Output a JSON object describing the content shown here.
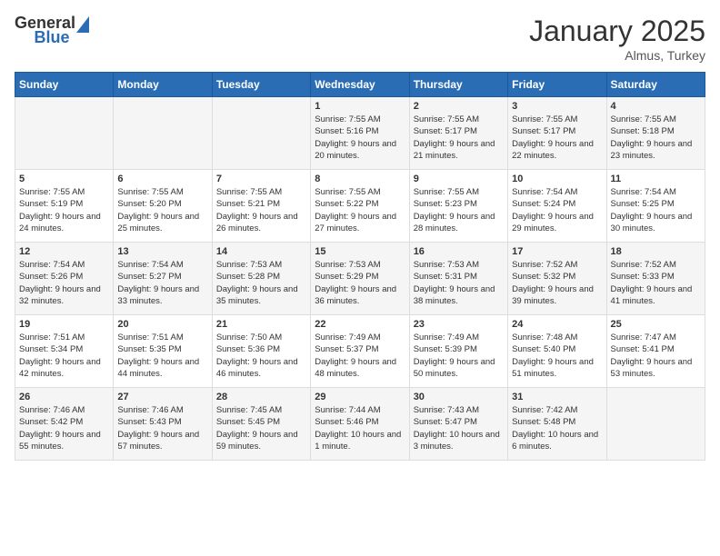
{
  "header": {
    "logo_general": "General",
    "logo_blue": "Blue",
    "month_title": "January 2025",
    "location": "Almus, Turkey"
  },
  "days_of_week": [
    "Sunday",
    "Monday",
    "Tuesday",
    "Wednesday",
    "Thursday",
    "Friday",
    "Saturday"
  ],
  "weeks": [
    {
      "days": [
        {
          "number": "",
          "sunrise": "",
          "sunset": "",
          "daylight": ""
        },
        {
          "number": "",
          "sunrise": "",
          "sunset": "",
          "daylight": ""
        },
        {
          "number": "",
          "sunrise": "",
          "sunset": "",
          "daylight": ""
        },
        {
          "number": "1",
          "sunrise": "Sunrise: 7:55 AM",
          "sunset": "Sunset: 5:16 PM",
          "daylight": "Daylight: 9 hours and 20 minutes."
        },
        {
          "number": "2",
          "sunrise": "Sunrise: 7:55 AM",
          "sunset": "Sunset: 5:17 PM",
          "daylight": "Daylight: 9 hours and 21 minutes."
        },
        {
          "number": "3",
          "sunrise": "Sunrise: 7:55 AM",
          "sunset": "Sunset: 5:17 PM",
          "daylight": "Daylight: 9 hours and 22 minutes."
        },
        {
          "number": "4",
          "sunrise": "Sunrise: 7:55 AM",
          "sunset": "Sunset: 5:18 PM",
          "daylight": "Daylight: 9 hours and 23 minutes."
        }
      ]
    },
    {
      "days": [
        {
          "number": "5",
          "sunrise": "Sunrise: 7:55 AM",
          "sunset": "Sunset: 5:19 PM",
          "daylight": "Daylight: 9 hours and 24 minutes."
        },
        {
          "number": "6",
          "sunrise": "Sunrise: 7:55 AM",
          "sunset": "Sunset: 5:20 PM",
          "daylight": "Daylight: 9 hours and 25 minutes."
        },
        {
          "number": "7",
          "sunrise": "Sunrise: 7:55 AM",
          "sunset": "Sunset: 5:21 PM",
          "daylight": "Daylight: 9 hours and 26 minutes."
        },
        {
          "number": "8",
          "sunrise": "Sunrise: 7:55 AM",
          "sunset": "Sunset: 5:22 PM",
          "daylight": "Daylight: 9 hours and 27 minutes."
        },
        {
          "number": "9",
          "sunrise": "Sunrise: 7:55 AM",
          "sunset": "Sunset: 5:23 PM",
          "daylight": "Daylight: 9 hours and 28 minutes."
        },
        {
          "number": "10",
          "sunrise": "Sunrise: 7:54 AM",
          "sunset": "Sunset: 5:24 PM",
          "daylight": "Daylight: 9 hours and 29 minutes."
        },
        {
          "number": "11",
          "sunrise": "Sunrise: 7:54 AM",
          "sunset": "Sunset: 5:25 PM",
          "daylight": "Daylight: 9 hours and 30 minutes."
        }
      ]
    },
    {
      "days": [
        {
          "number": "12",
          "sunrise": "Sunrise: 7:54 AM",
          "sunset": "Sunset: 5:26 PM",
          "daylight": "Daylight: 9 hours and 32 minutes."
        },
        {
          "number": "13",
          "sunrise": "Sunrise: 7:54 AM",
          "sunset": "Sunset: 5:27 PM",
          "daylight": "Daylight: 9 hours and 33 minutes."
        },
        {
          "number": "14",
          "sunrise": "Sunrise: 7:53 AM",
          "sunset": "Sunset: 5:28 PM",
          "daylight": "Daylight: 9 hours and 35 minutes."
        },
        {
          "number": "15",
          "sunrise": "Sunrise: 7:53 AM",
          "sunset": "Sunset: 5:29 PM",
          "daylight": "Daylight: 9 hours and 36 minutes."
        },
        {
          "number": "16",
          "sunrise": "Sunrise: 7:53 AM",
          "sunset": "Sunset: 5:31 PM",
          "daylight": "Daylight: 9 hours and 38 minutes."
        },
        {
          "number": "17",
          "sunrise": "Sunrise: 7:52 AM",
          "sunset": "Sunset: 5:32 PM",
          "daylight": "Daylight: 9 hours and 39 minutes."
        },
        {
          "number": "18",
          "sunrise": "Sunrise: 7:52 AM",
          "sunset": "Sunset: 5:33 PM",
          "daylight": "Daylight: 9 hours and 41 minutes."
        }
      ]
    },
    {
      "days": [
        {
          "number": "19",
          "sunrise": "Sunrise: 7:51 AM",
          "sunset": "Sunset: 5:34 PM",
          "daylight": "Daylight: 9 hours and 42 minutes."
        },
        {
          "number": "20",
          "sunrise": "Sunrise: 7:51 AM",
          "sunset": "Sunset: 5:35 PM",
          "daylight": "Daylight: 9 hours and 44 minutes."
        },
        {
          "number": "21",
          "sunrise": "Sunrise: 7:50 AM",
          "sunset": "Sunset: 5:36 PM",
          "daylight": "Daylight: 9 hours and 46 minutes."
        },
        {
          "number": "22",
          "sunrise": "Sunrise: 7:49 AM",
          "sunset": "Sunset: 5:37 PM",
          "daylight": "Daylight: 9 hours and 48 minutes."
        },
        {
          "number": "23",
          "sunrise": "Sunrise: 7:49 AM",
          "sunset": "Sunset: 5:39 PM",
          "daylight": "Daylight: 9 hours and 50 minutes."
        },
        {
          "number": "24",
          "sunrise": "Sunrise: 7:48 AM",
          "sunset": "Sunset: 5:40 PM",
          "daylight": "Daylight: 9 hours and 51 minutes."
        },
        {
          "number": "25",
          "sunrise": "Sunrise: 7:47 AM",
          "sunset": "Sunset: 5:41 PM",
          "daylight": "Daylight: 9 hours and 53 minutes."
        }
      ]
    },
    {
      "days": [
        {
          "number": "26",
          "sunrise": "Sunrise: 7:46 AM",
          "sunset": "Sunset: 5:42 PM",
          "daylight": "Daylight: 9 hours and 55 minutes."
        },
        {
          "number": "27",
          "sunrise": "Sunrise: 7:46 AM",
          "sunset": "Sunset: 5:43 PM",
          "daylight": "Daylight: 9 hours and 57 minutes."
        },
        {
          "number": "28",
          "sunrise": "Sunrise: 7:45 AM",
          "sunset": "Sunset: 5:45 PM",
          "daylight": "Daylight: 9 hours and 59 minutes."
        },
        {
          "number": "29",
          "sunrise": "Sunrise: 7:44 AM",
          "sunset": "Sunset: 5:46 PM",
          "daylight": "Daylight: 10 hours and 1 minute."
        },
        {
          "number": "30",
          "sunrise": "Sunrise: 7:43 AM",
          "sunset": "Sunset: 5:47 PM",
          "daylight": "Daylight: 10 hours and 3 minutes."
        },
        {
          "number": "31",
          "sunrise": "Sunrise: 7:42 AM",
          "sunset": "Sunset: 5:48 PM",
          "daylight": "Daylight: 10 hours and 6 minutes."
        },
        {
          "number": "",
          "sunrise": "",
          "sunset": "",
          "daylight": ""
        }
      ]
    }
  ]
}
